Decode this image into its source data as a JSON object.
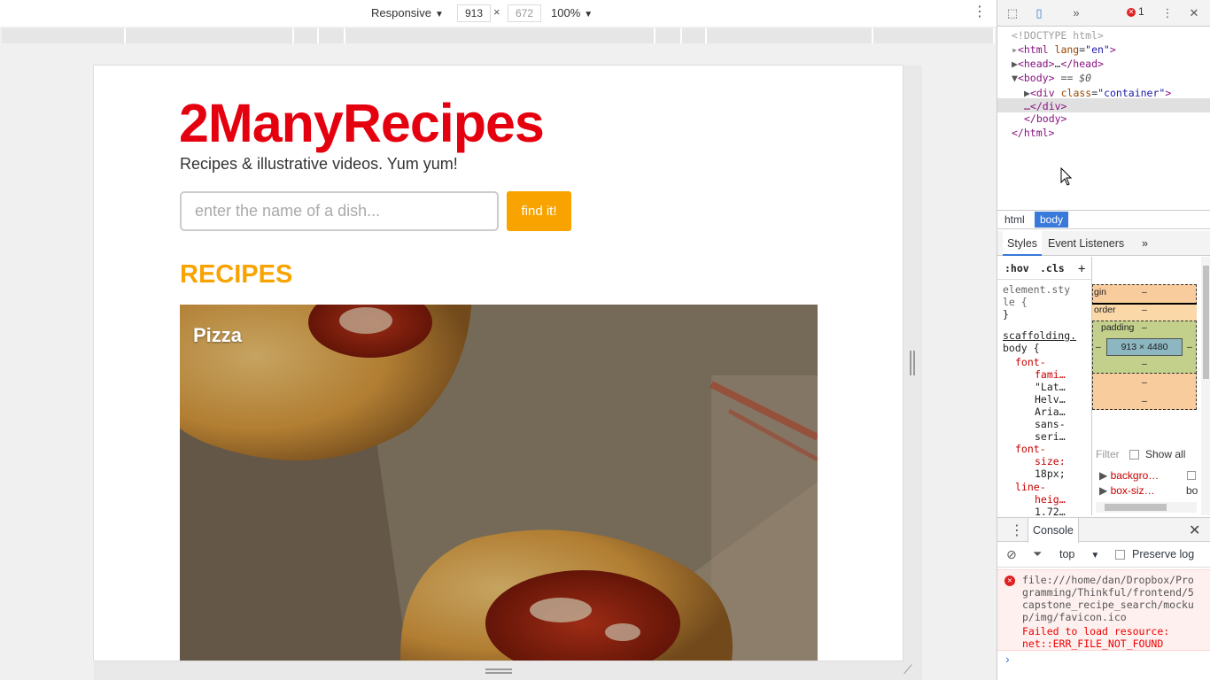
{
  "emulator": {
    "device": "Responsive",
    "width": "913",
    "height": "672",
    "zoom": "100%"
  },
  "page": {
    "title": "2ManyRecipes",
    "tagline": "Recipes & illustrative videos. Yum yum!",
    "search_placeholder": "enter the name of a dish...",
    "find_button": "find it!",
    "recipes_heading": "RECIPES",
    "recipe_card_title": "Pizza"
  },
  "devtools": {
    "error_count": "1",
    "dom": {
      "doctype": "<!DOCTYPE html>",
      "html_open_tag": "html",
      "html_attr": "lang",
      "html_attr_val": "\"en\"",
      "head": "head",
      "head_ellipsis": "…",
      "body": "body",
      "body_marker": "== $0",
      "div_tag": "div",
      "div_attr": "class",
      "div_attr_val": "\"container\"",
      "div_close": "…</div>",
      "body_close": "</body>",
      "html_close": "</html>"
    },
    "breadcrumbs": [
      "html",
      "body"
    ],
    "panel_tabs": [
      "Styles",
      "Event Listeners"
    ],
    "styles": {
      "hov": ":hov",
      "cls": ".cls",
      "element_style_1": "element.sty",
      "element_style_2": "le {",
      "close_brace": "}",
      "source_link": "scaffolding.",
      "selector": "body {",
      "font_family_1": "font-",
      "font_family_2": "fami…",
      "ff_v1": "\"Lat…",
      "ff_v2": "Helv…",
      "ff_v3": "Aria…",
      "ff_v4": "sans-",
      "ff_v5": "seri…",
      "font_size_1": "font-",
      "font_size_2": "size:",
      "font_size_val": "18px;",
      "line_height_1": "line-",
      "line_height_2": "heig…",
      "line_height_val": "1.72…"
    },
    "box_model": {
      "margin_label": "gin",
      "border_label": "order",
      "padding_label": "padding",
      "dash": "–",
      "content": "913 × 4480",
      "filter_placeholder": "Filter",
      "show_all": "Show all",
      "computed_1": "backgro…",
      "computed_2": "box-siz…",
      "computed_2_val": "bo"
    },
    "console": {
      "tab": "Console",
      "context": "top",
      "preserve_log": "Preserve log",
      "message_path": "file:///home/dan/Dropbox/Programming/Thinkful/frontend/5capstone_recipe_search/mockup/img/favicon.ico",
      "message_error": "Failed to load resource: net::ERR_FILE_NOT_FOUND"
    }
  }
}
